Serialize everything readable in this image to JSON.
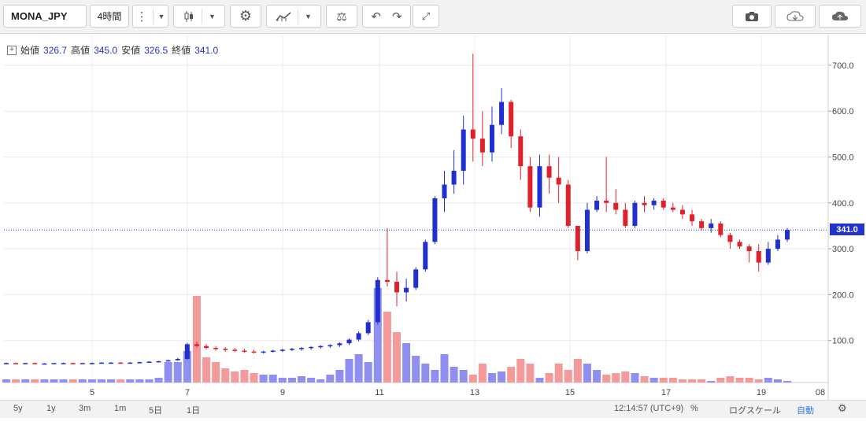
{
  "toolbar": {
    "symbol": "MONA_JPY",
    "interval": "4時間",
    "icons": [
      "more-vertical-icon",
      "chevron-down-icon",
      "candlestick-icon",
      "chevron-down-icon",
      "gear-icon",
      "indicator-icon",
      "chevron-down-icon",
      "compare-icon",
      "undo-icon",
      "redo-icon",
      "fullscreen-icon",
      "camera-icon",
      "cloud-download-icon",
      "cloud-upload-icon"
    ]
  },
  "ohlc": {
    "open_label": "始値",
    "open": "326.7",
    "high_label": "高値",
    "high": "345.0",
    "low_label": "安値",
    "low": "326.5",
    "close_label": "終値",
    "close": "341.0"
  },
  "price_tag": "341.0",
  "bottom": {
    "ranges": [
      "5y",
      "1y",
      "3m",
      "1m",
      "5日",
      "1日"
    ],
    "time": "12:14:57 (UTC+9)",
    "percent": "%",
    "log": "ログスケール",
    "auto": "自動"
  },
  "colors": {
    "up": "#1f2fd0",
    "down": "#e0202a",
    "vol_up": "#8f8ff2",
    "vol_down": "#f59a9a",
    "grid": "#ececec"
  },
  "chart_data": {
    "type": "candlestick",
    "y_ticks": [
      "100.0",
      "200.0",
      "300.0",
      "400.0",
      "500.0",
      "600.0",
      "700.0"
    ],
    "x_ticks": [
      "5",
      "7",
      "9",
      "11",
      "13",
      "15",
      "17",
      "19",
      "08"
    ],
    "candles": [
      [
        50,
        52,
        48,
        51
      ],
      [
        51,
        52,
        49,
        50
      ],
      [
        50,
        51,
        49,
        51
      ],
      [
        51,
        52,
        50,
        50
      ],
      [
        50,
        51,
        49,
        50
      ],
      [
        50,
        51,
        49,
        51
      ],
      [
        51,
        52,
        50,
        51
      ],
      [
        51,
        52,
        50,
        50
      ],
      [
        50,
        51,
        49,
        51
      ],
      [
        51,
        52,
        50,
        51
      ],
      [
        51,
        53,
        50,
        52
      ],
      [
        52,
        53,
        51,
        52
      ],
      [
        52,
        53,
        50,
        51
      ],
      [
        51,
        53,
        50,
        52
      ],
      [
        52,
        54,
        51,
        53
      ],
      [
        53,
        55,
        52,
        54
      ],
      [
        54,
        56,
        53,
        55
      ],
      [
        55,
        58,
        54,
        57
      ],
      [
        57,
        62,
        56,
        60
      ],
      [
        60,
        95,
        58,
        92
      ],
      [
        92,
        98,
        85,
        88
      ],
      [
        88,
        92,
        80,
        84
      ],
      [
        84,
        88,
        78,
        82
      ],
      [
        82,
        86,
        76,
        80
      ],
      [
        80,
        84,
        75,
        78
      ],
      [
        78,
        82,
        73,
        76
      ],
      [
        76,
        80,
        72,
        74
      ],
      [
        74,
        78,
        72,
        76
      ],
      [
        76,
        80,
        74,
        78
      ],
      [
        78,
        82,
        75,
        80
      ],
      [
        80,
        84,
        77,
        82
      ],
      [
        82,
        86,
        78,
        84
      ],
      [
        84,
        88,
        80,
        86
      ],
      [
        86,
        90,
        82,
        88
      ],
      [
        88,
        92,
        84,
        90
      ],
      [
        90,
        96,
        86,
        94
      ],
      [
        94,
        105,
        90,
        102
      ],
      [
        102,
        120,
        98,
        116
      ],
      [
        116,
        145,
        112,
        140
      ],
      [
        140,
        238,
        135,
        232
      ],
      [
        232,
        345,
        218,
        228
      ],
      [
        228,
        250,
        175,
        205
      ],
      [
        205,
        235,
        185,
        215
      ],
      [
        215,
        260,
        210,
        255
      ],
      [
        255,
        320,
        250,
        315
      ],
      [
        315,
        415,
        310,
        410
      ],
      [
        410,
        470,
        380,
        440
      ],
      [
        440,
        515,
        420,
        470
      ],
      [
        470,
        590,
        440,
        560
      ],
      [
        560,
        725,
        490,
        540
      ],
      [
        540,
        600,
        480,
        510
      ],
      [
        510,
        610,
        490,
        570
      ],
      [
        570,
        650,
        550,
        620
      ],
      [
        620,
        625,
        520,
        545
      ],
      [
        545,
        560,
        450,
        480
      ],
      [
        480,
        500,
        380,
        390
      ],
      [
        390,
        505,
        370,
        480
      ],
      [
        480,
        505,
        420,
        455
      ],
      [
        455,
        500,
        400,
        440
      ],
      [
        440,
        450,
        345,
        350
      ],
      [
        350,
        350,
        275,
        295
      ],
      [
        295,
        400,
        290,
        385
      ],
      [
        385,
        415,
        380,
        405
      ],
      [
        405,
        500,
        380,
        400
      ],
      [
        400,
        430,
        375,
        385
      ],
      [
        385,
        400,
        345,
        350
      ],
      [
        350,
        405,
        345,
        400
      ],
      [
        400,
        415,
        380,
        395
      ],
      [
        395,
        410,
        385,
        405
      ],
      [
        405,
        410,
        385,
        390
      ],
      [
        390,
        400,
        380,
        385
      ],
      [
        385,
        395,
        365,
        375
      ],
      [
        375,
        385,
        350,
        360
      ],
      [
        360,
        365,
        340,
        345
      ],
      [
        345,
        365,
        335,
        355
      ],
      [
        355,
        360,
        325,
        330
      ],
      [
        330,
        335,
        300,
        315
      ],
      [
        315,
        320,
        300,
        305
      ],
      [
        305,
        310,
        270,
        295
      ],
      [
        295,
        310,
        250,
        270
      ],
      [
        270,
        315,
        265,
        300
      ],
      [
        300,
        330,
        295,
        320
      ],
      [
        320,
        345,
        315,
        341
      ]
    ],
    "volume": [
      0.02,
      0.02,
      0.02,
      0.02,
      0.02,
      0.02,
      0.02,
      0.02,
      0.02,
      0.02,
      0.02,
      0.02,
      0.02,
      0.02,
      0.02,
      0.02,
      0.03,
      0.13,
      0.13,
      0.2,
      0.55,
      0.16,
      0.13,
      0.09,
      0.07,
      0.08,
      0.06,
      0.05,
      0.05,
      0.03,
      0.03,
      0.04,
      0.03,
      0.02,
      0.05,
      0.08,
      0.15,
      0.18,
      0.13,
      0.6,
      0.45,
      0.32,
      0.25,
      0.17,
      0.12,
      0.08,
      0.18,
      0.1,
      0.08,
      0.05,
      0.12,
      0.06,
      0.07,
      0.1,
      0.15,
      0.12,
      0.03,
      0.06,
      0.12,
      0.08,
      0.15,
      0.12,
      0.08,
      0.05,
      0.06,
      0.07,
      0.06,
      0.04,
      0.03,
      0.03,
      0.03,
      0.02,
      0.02,
      0.02,
      0.01,
      0.03,
      0.04,
      0.03,
      0.03,
      0.02,
      0.03,
      0.02,
      0.01
    ]
  }
}
